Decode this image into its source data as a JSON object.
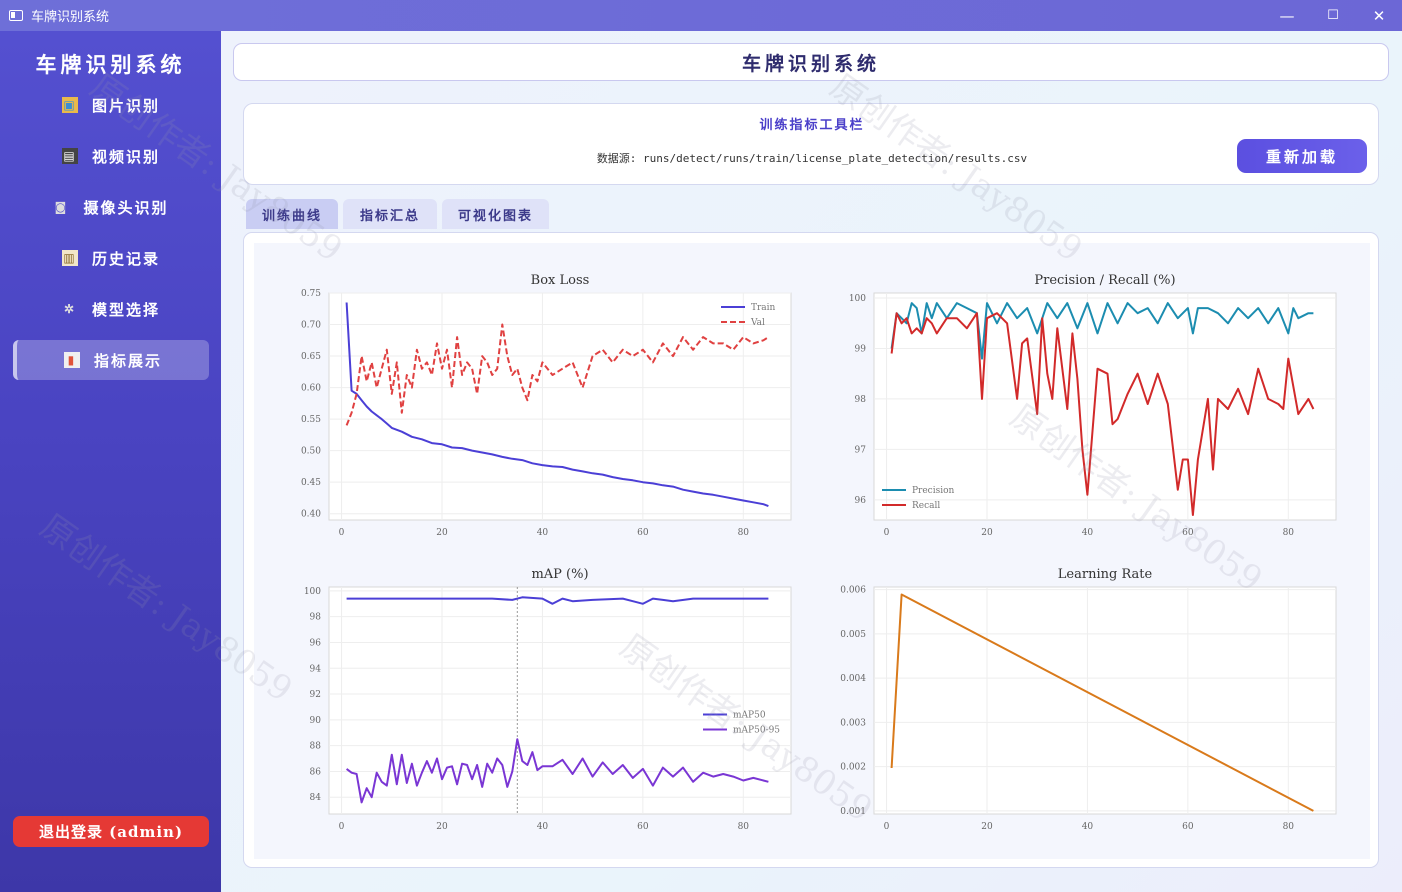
{
  "window": {
    "title": "车牌识别系统",
    "minimize": "—",
    "maximize": "☐",
    "close": "✕"
  },
  "sidebar": {
    "brand": "车牌识别系统",
    "items": [
      {
        "label": "图片识别",
        "icon": "image-icon",
        "glyph": "▣"
      },
      {
        "label": "视频识别",
        "icon": "clapper-icon",
        "glyph": "▤"
      },
      {
        "label": "摄像头识别",
        "icon": "camera-icon",
        "glyph": "◙"
      },
      {
        "label": "历史记录",
        "icon": "clipboard-icon",
        "glyph": "▥"
      },
      {
        "label": "模型选择",
        "icon": "gear-icon",
        "glyph": "✲"
      },
      {
        "label": "指标展示",
        "icon": "chart-icon",
        "glyph": "▮"
      }
    ],
    "logout": "退出登录 (admin)"
  },
  "header": {
    "title": "车牌识别系统"
  },
  "toolbar": {
    "title": "训练指标工具栏",
    "source": "数据源: runs/detect/runs/train/license_plate_detection/results.csv",
    "reload": "重新加载"
  },
  "tabs": [
    {
      "label": "训练曲线"
    },
    {
      "label": "指标汇总"
    },
    {
      "label": "可视化图表"
    }
  ],
  "watermark": "原创作者: Jay8059",
  "colors": {
    "train": "#4b3fd6",
    "val": "#e04141",
    "precision": "#1c8db0",
    "recall": "#d22a2a",
    "map50": "#4b3fd6",
    "map5095": "#7a36d4",
    "lr": "#d97a1b"
  },
  "chart_data": [
    {
      "type": "line",
      "title": "Box Loss",
      "xlim": [
        0,
        85
      ],
      "ylim": [
        0.39,
        0.75
      ],
      "xticks": [
        "0",
        "20",
        "40",
        "60",
        "80"
      ],
      "yticks": [
        "0.40",
        "0.45",
        "0.50",
        "0.55",
        "0.60",
        "0.65",
        "0.70",
        "0.75"
      ],
      "legend_position": "top-right",
      "series": [
        {
          "name": "Train",
          "style": "solid",
          "x": [
            1,
            2,
            3,
            4,
            5,
            6,
            7,
            8,
            9,
            10,
            12,
            14,
            16,
            18,
            20,
            22,
            24,
            26,
            28,
            30,
            32,
            34,
            36,
            38,
            40,
            42,
            44,
            46,
            48,
            50,
            52,
            54,
            56,
            58,
            60,
            62,
            64,
            66,
            68,
            70,
            72,
            74,
            76,
            78,
            80,
            82,
            84,
            85
          ],
          "values": [
            0.735,
            0.595,
            0.59,
            0.58,
            0.57,
            0.562,
            0.556,
            0.55,
            0.543,
            0.536,
            0.53,
            0.522,
            0.518,
            0.512,
            0.51,
            0.505,
            0.504,
            0.5,
            0.497,
            0.494,
            0.49,
            0.487,
            0.485,
            0.48,
            0.477,
            0.475,
            0.474,
            0.47,
            0.467,
            0.464,
            0.462,
            0.458,
            0.455,
            0.453,
            0.45,
            0.448,
            0.445,
            0.443,
            0.438,
            0.435,
            0.432,
            0.43,
            0.427,
            0.424,
            0.421,
            0.418,
            0.415,
            0.412
          ]
        },
        {
          "name": "Val",
          "style": "dashed",
          "x": [
            1,
            2,
            3,
            4,
            5,
            6,
            7,
            8,
            9,
            10,
            11,
            12,
            13,
            14,
            15,
            16,
            17,
            18,
            19,
            20,
            21,
            22,
            23,
            24,
            25,
            26,
            27,
            28,
            29,
            30,
            31,
            32,
            33,
            34,
            35,
            36,
            37,
            38,
            39,
            40,
            42,
            44,
            46,
            48,
            50,
            52,
            54,
            56,
            58,
            60,
            62,
            64,
            66,
            68,
            70,
            72,
            74,
            76,
            78,
            80,
            82,
            84,
            85
          ],
          "values": [
            0.54,
            0.56,
            0.59,
            0.65,
            0.61,
            0.64,
            0.6,
            0.63,
            0.66,
            0.59,
            0.64,
            0.56,
            0.62,
            0.6,
            0.66,
            0.63,
            0.64,
            0.62,
            0.67,
            0.63,
            0.66,
            0.6,
            0.68,
            0.62,
            0.64,
            0.63,
            0.59,
            0.65,
            0.64,
            0.62,
            0.63,
            0.7,
            0.65,
            0.62,
            0.63,
            0.6,
            0.58,
            0.62,
            0.61,
            0.64,
            0.62,
            0.63,
            0.64,
            0.6,
            0.65,
            0.66,
            0.64,
            0.66,
            0.65,
            0.66,
            0.64,
            0.67,
            0.65,
            0.68,
            0.66,
            0.68,
            0.67,
            0.67,
            0.66,
            0.68,
            0.67,
            0.675,
            0.68
          ]
        }
      ]
    },
    {
      "type": "line",
      "title": "Precision / Recall (%)",
      "xlim": [
        0,
        85
      ],
      "ylim": [
        95.6,
        100.1
      ],
      "xticks": [
        "0",
        "20",
        "40",
        "60",
        "80"
      ],
      "yticks": [
        "96",
        "97",
        "98",
        "99",
        "100"
      ],
      "legend_position": "bottom-left",
      "series": [
        {
          "name": "Precision",
          "x": [
            1,
            2,
            3,
            4,
            5,
            6,
            7,
            8,
            9,
            10,
            12,
            14,
            16,
            18,
            19,
            20,
            22,
            24,
            26,
            28,
            30,
            32,
            34,
            36,
            38,
            40,
            42,
            44,
            46,
            48,
            50,
            52,
            54,
            56,
            58,
            60,
            61,
            62,
            64,
            66,
            68,
            70,
            72,
            74,
            76,
            78,
            80,
            81,
            82,
            84,
            85
          ],
          "values": [
            99.0,
            99.7,
            99.6,
            99.5,
            99.9,
            99.8,
            99.3,
            99.9,
            99.6,
            99.9,
            99.6,
            99.9,
            99.8,
            99.7,
            98.8,
            99.9,
            99.5,
            99.9,
            99.6,
            99.8,
            99.3,
            99.9,
            99.6,
            99.9,
            99.4,
            99.9,
            99.3,
            99.9,
            99.5,
            99.9,
            99.7,
            99.8,
            99.5,
            99.9,
            99.6,
            99.8,
            99.3,
            99.8,
            99.8,
            99.7,
            99.5,
            99.8,
            99.6,
            99.8,
            99.5,
            99.8,
            99.3,
            99.8,
            99.6,
            99.7,
            99.7
          ]
        },
        {
          "name": "Recall",
          "x": [
            1,
            2,
            3,
            4,
            5,
            6,
            7,
            8,
            9,
            10,
            12,
            14,
            16,
            18,
            19,
            20,
            22,
            24,
            26,
            27,
            28,
            30,
            31,
            32,
            33,
            34,
            36,
            37,
            38,
            39,
            40,
            42,
            44,
            45,
            46,
            48,
            50,
            52,
            54,
            56,
            58,
            59,
            60,
            61,
            62,
            64,
            65,
            66,
            68,
            70,
            72,
            74,
            76,
            78,
            79,
            80,
            82,
            84,
            85
          ],
          "values": [
            98.9,
            99.7,
            99.5,
            99.6,
            99.3,
            99.4,
            99.3,
            99.6,
            99.5,
            99.3,
            99.6,
            99.6,
            99.4,
            99.7,
            98.0,
            99.6,
            99.7,
            99.5,
            98.0,
            99.1,
            99.2,
            97.7,
            99.6,
            98.5,
            98.0,
            99.4,
            97.8,
            99.3,
            98.4,
            97.0,
            96.1,
            98.6,
            98.5,
            97.5,
            97.6,
            98.1,
            98.5,
            97.9,
            98.5,
            97.9,
            96.2,
            96.8,
            96.8,
            95.7,
            96.8,
            98.0,
            96.6,
            98.0,
            97.8,
            98.2,
            97.7,
            98.6,
            98.0,
            97.9,
            97.8,
            98.8,
            97.7,
            98.0,
            97.8
          ]
        }
      ]
    },
    {
      "type": "line",
      "title": "mAP (%)",
      "xlim": [
        0,
        85
      ],
      "ylim": [
        82.7,
        100.3
      ],
      "xticks": [
        "0",
        "20",
        "40",
        "60",
        "80"
      ],
      "yticks": [
        "84",
        "86",
        "88",
        "90",
        "92",
        "94",
        "96",
        "98",
        "100"
      ],
      "legend_position": "center-right",
      "marker_x": 35,
      "series": [
        {
          "name": "mAP50",
          "x": [
            1,
            5,
            10,
            20,
            30,
            34,
            36,
            40,
            42,
            44,
            46,
            50,
            56,
            58,
            60,
            62,
            64,
            66,
            70,
            75,
            80,
            85
          ],
          "values": [
            99.4,
            99.4,
            99.4,
            99.4,
            99.4,
            99.3,
            99.5,
            99.4,
            99.0,
            99.4,
            99.2,
            99.3,
            99.4,
            99.2,
            99.0,
            99.4,
            99.3,
            99.2,
            99.4,
            99.4,
            99.4,
            99.4
          ]
        },
        {
          "name": "mAP50-95",
          "x": [
            1,
            2,
            3,
            4,
            5,
            6,
            7,
            8,
            9,
            10,
            11,
            12,
            13,
            14,
            15,
            16,
            17,
            18,
            19,
            20,
            21,
            22,
            23,
            24,
            25,
            26,
            27,
            28,
            29,
            30,
            31,
            32,
            33,
            34,
            35,
            36,
            37,
            38,
            39,
            40,
            42,
            44,
            46,
            48,
            50,
            52,
            54,
            56,
            58,
            60,
            62,
            64,
            66,
            68,
            70,
            72,
            74,
            76,
            78,
            80,
            82,
            84,
            85
          ],
          "values": [
            86.2,
            85.9,
            85.8,
            83.6,
            84.7,
            84.0,
            85.9,
            85.2,
            84.9,
            87.3,
            85.0,
            87.3,
            85.1,
            86.6,
            84.9,
            85.9,
            86.8,
            85.9,
            87.0,
            85.4,
            86.3,
            86.4,
            85.0,
            86.6,
            86.5,
            85.4,
            86.5,
            84.8,
            86.6,
            85.9,
            87.0,
            86.5,
            84.8,
            86.0,
            88.5,
            86.8,
            86.5,
            87.5,
            86.1,
            86.4,
            86.4,
            86.9,
            85.8,
            87.0,
            85.6,
            86.7,
            85.8,
            86.5,
            85.5,
            86.2,
            84.9,
            86.3,
            85.6,
            86.3,
            85.2,
            85.9,
            85.6,
            85.8,
            85.6,
            85.3,
            85.5,
            85.3,
            85.2
          ]
        }
      ]
    },
    {
      "type": "line",
      "title": "Learning Rate",
      "xlim": [
        0,
        85
      ],
      "ylim": [
        0.00093,
        0.00606
      ],
      "xticks": [
        "0",
        "20",
        "40",
        "60",
        "80"
      ],
      "yticks": [
        "0.001",
        "0.002",
        "0.003",
        "0.004",
        "0.005",
        "0.006"
      ],
      "series": [
        {
          "x": [
            1,
            3,
            85
          ],
          "values": [
            0.00197,
            0.00589,
            0.001
          ]
        }
      ]
    }
  ]
}
